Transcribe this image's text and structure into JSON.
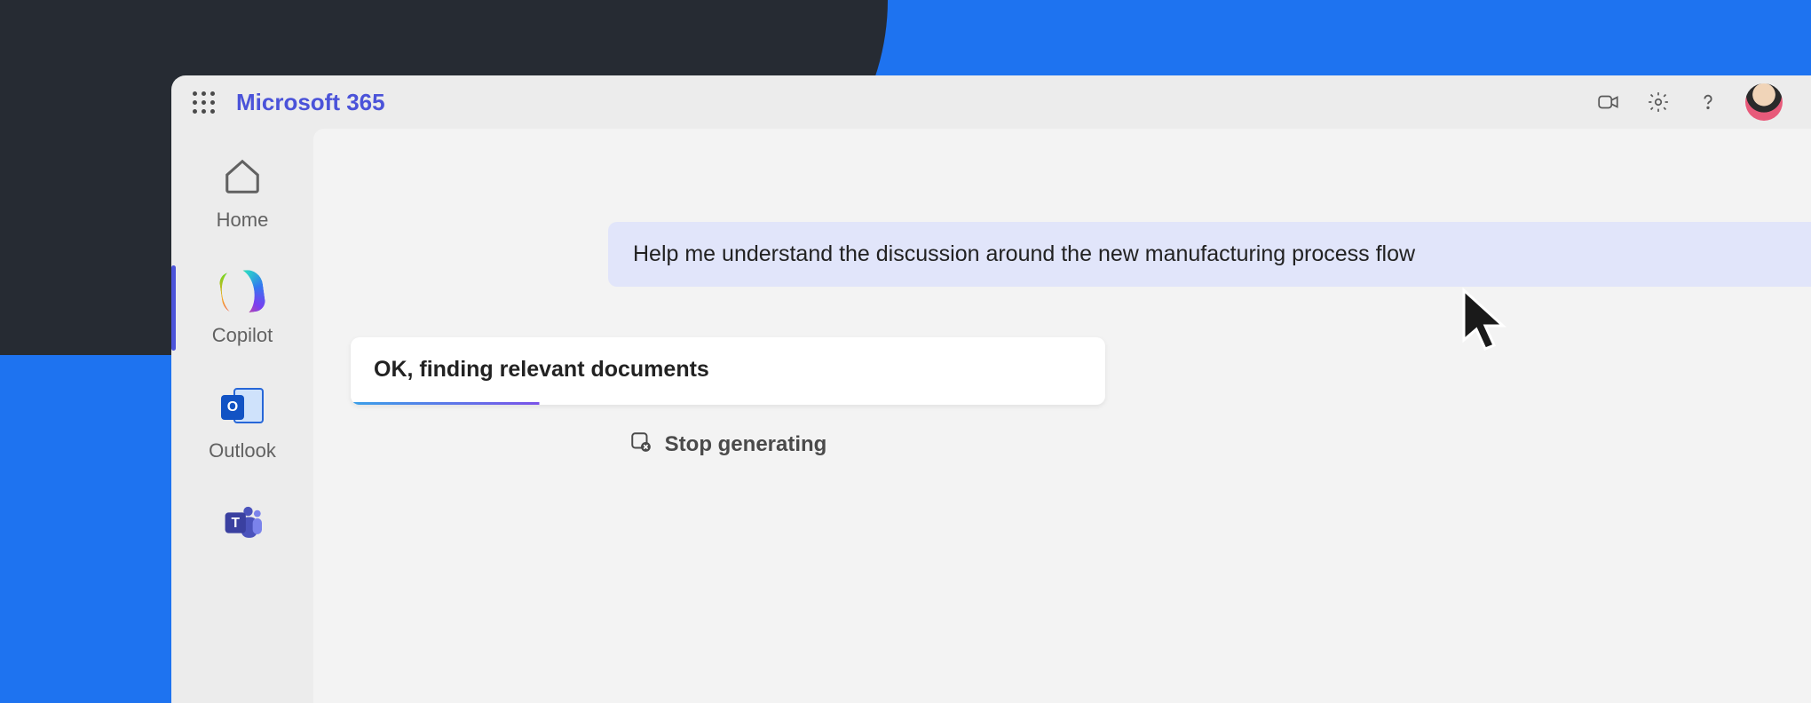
{
  "header": {
    "brand": "Microsoft 365"
  },
  "sidebar": {
    "items": [
      {
        "label": "Home",
        "icon": "home-icon"
      },
      {
        "label": "Copilot",
        "icon": "copilot-icon"
      },
      {
        "label": "Outlook",
        "icon": "outlook-icon"
      },
      {
        "label": "",
        "icon": "teams-icon"
      }
    ],
    "active_index": 1
  },
  "chat": {
    "user_message": "Help me understand the discussion around the new manufacturing process flow",
    "assistant_status": "OK, finding relevant documents",
    "stop_label": "Stop generating"
  }
}
